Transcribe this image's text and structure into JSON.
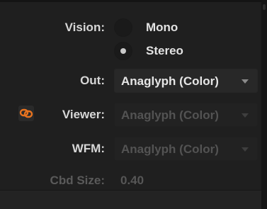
{
  "vision": {
    "label": "Vision:",
    "options": [
      {
        "label": "Mono",
        "selected": false
      },
      {
        "label": "Stereo",
        "selected": true
      }
    ]
  },
  "out": {
    "label": "Out:",
    "value": "Anaglyph (Color)"
  },
  "viewer": {
    "label": "Viewer:",
    "value": "Anaglyph (Color)",
    "disabled": true,
    "link_icon": "link-icon",
    "link_color": "#e8731f"
  },
  "wfm": {
    "label": "WFM:",
    "value": "Anaglyph (Color)",
    "disabled": true
  },
  "cbd_size": {
    "label": "Cbd Size:",
    "value": "0.40",
    "disabled": true
  }
}
